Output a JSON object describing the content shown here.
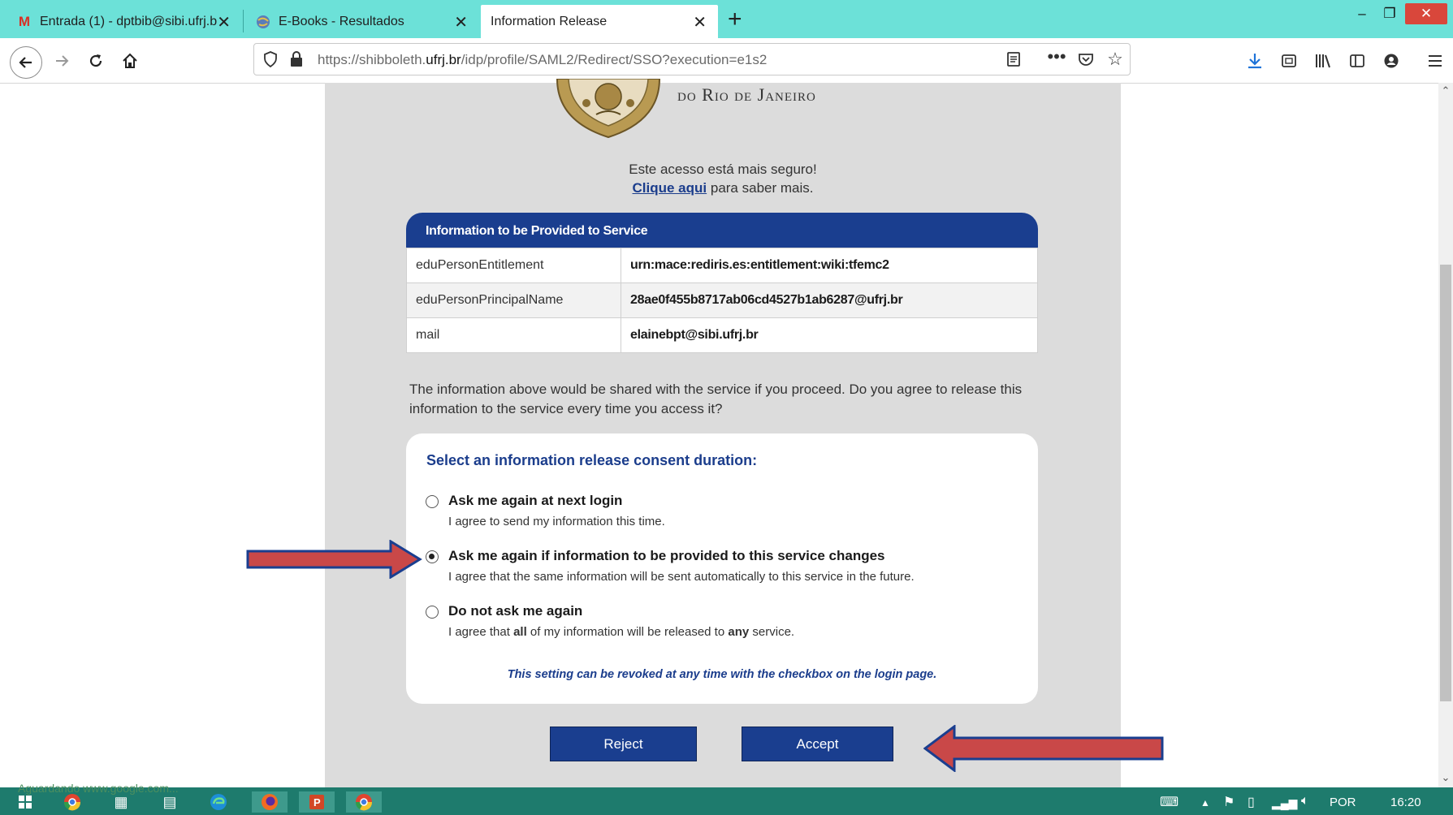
{
  "browser": {
    "tabs": [
      {
        "label": "Entrada (1) - dptbib@sibi.ufrj.b",
        "icon": "gmail-icon"
      },
      {
        "label": "E-Books - Resultados",
        "icon": "globe-icon"
      },
      {
        "label": "Information Release",
        "icon": "none",
        "active": true
      }
    ],
    "url_prefix": "https://shibboleth.",
    "url_domain": "ufrj.br",
    "url_path": "/idp/profile/SAML2/Redirect/SSO?execution=e1s2"
  },
  "page": {
    "university_name": "do Rio de Janeiro",
    "secure_text": "Este acesso está mais seguro!",
    "learn_link": "Clique aqui",
    "learn_suffix": " para saber mais.",
    "info_header": "Information to be Provided to Service",
    "attributes": [
      {
        "name": "eduPersonEntitlement",
        "value": "urn:mace:rediris.es:entitlement:wiki:tfemc2"
      },
      {
        "name": "eduPersonPrincipalName",
        "value": "28ae0f455b8717ab06cd4527b1ab6287@ufrj.br"
      },
      {
        "name": "mail",
        "value": "elainebpt@sibi.ufrj.br"
      }
    ],
    "notice": "The information above would be shared with the service if you proceed. Do you agree to release this information to the service every time you access it?",
    "consent_title": "Select an information release consent duration:",
    "options": [
      {
        "label": "Ask me again at next login",
        "desc": "I agree to send my information this time.",
        "checked": false
      },
      {
        "label": "Ask me again if information to be provided to this service changes",
        "desc": "I agree that the same information will be sent automatically to this service in the future.",
        "checked": true
      },
      {
        "label": "Do not ask me again",
        "desc_pre": "I agree that ",
        "desc_b1": "all",
        "desc_mid": " of my information will be released to ",
        "desc_b2": "any",
        "desc_post": " service.",
        "checked": false
      }
    ],
    "revoke_note": "This setting can be revoked at any time with the checkbox on the login page.",
    "reject_label": "Reject",
    "accept_label": "Accept"
  },
  "status": {
    "loading_text": "Aguardando www.google.com..."
  },
  "taskbar": {
    "language": "POR",
    "time": "16:20"
  },
  "colors": {
    "tabstrip": "#6ce1d8",
    "brand_blue": "#1a3e8f",
    "annotation_arrow": "#c94848",
    "taskbar": "#1e7b6d"
  }
}
